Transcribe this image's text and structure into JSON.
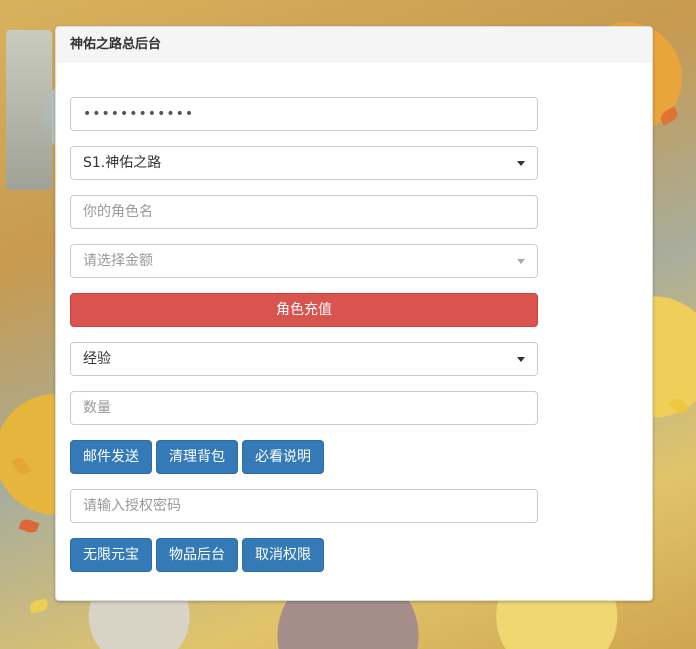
{
  "panel": {
    "title": "神佑之路总后台"
  },
  "form": {
    "password_value": "••••••••••••",
    "server_select": "S1.神佑之路",
    "role_name_placeholder": "你的角色名",
    "amount_select_placeholder": "请选择金额",
    "recharge_button": "角色充值",
    "item_type_select": "经验",
    "quantity_placeholder": "数量",
    "action_buttons": [
      "邮件发送",
      "清理背包",
      "必看说明"
    ],
    "auth_password_placeholder": "请输入授权密码",
    "admin_buttons": [
      "无限元宝",
      "物品后台",
      "取消权限"
    ]
  },
  "colors": {
    "danger": "#d9534f",
    "primary": "#337ab7",
    "heading_bg": "#f5f5f5"
  }
}
